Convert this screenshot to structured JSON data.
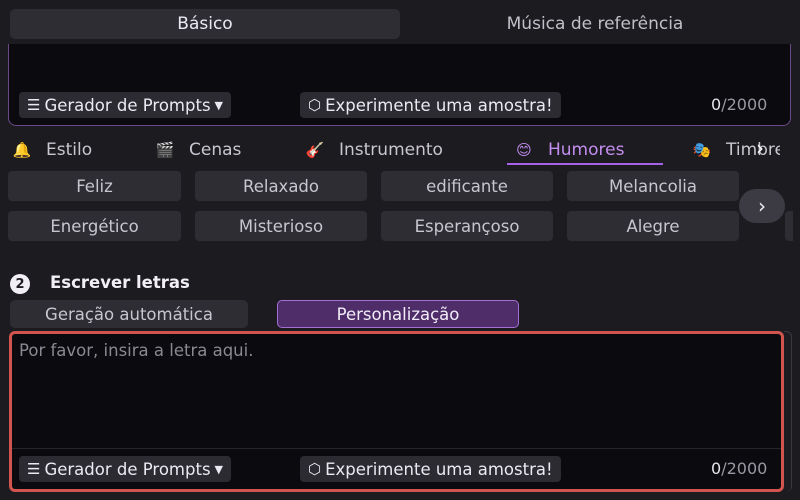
{
  "top_tabs": {
    "basic": "Básico",
    "reference": "Música de referência"
  },
  "prompt_box": {
    "prompt_generator": "Gerador de Prompts",
    "try_sample": "Experimente uma amostra!",
    "counter_current": "0",
    "counter_max": "/2000"
  },
  "categories": [
    {
      "label": "Estilo",
      "icon": "bell-icon",
      "glyph": "🔔"
    },
    {
      "label": "Cenas",
      "icon": "clapper-icon",
      "glyph": "🎬"
    },
    {
      "label": "Instrumento",
      "icon": "guitar-icon",
      "glyph": "🎸"
    },
    {
      "label": "Humores",
      "icon": "smile-icon",
      "glyph": "😊"
    },
    {
      "label": "Timbre",
      "icon": "voice-icon",
      "glyph": "🎭"
    }
  ],
  "moods": {
    "row1": [
      "Feliz",
      "Relaxado",
      "edificante",
      "Melancolia"
    ],
    "row2": [
      "Energético",
      "Misterioso",
      "Esperançoso",
      "Alegre"
    ]
  },
  "lyrics_section": {
    "step_number": "2",
    "title": "Escrever letras",
    "mode_auto": "Geração automática",
    "mode_custom": "Personalização",
    "placeholder": "Por favor, insira a letra aqui.",
    "prompt_generator": "Gerador de Prompts",
    "try_sample": "Experimente uma amostra!",
    "counter_current": "0",
    "counter_max": "/2000"
  },
  "colors": {
    "accent": "#a561e8",
    "highlight": "#d2544e",
    "background": "#1c1b20"
  }
}
